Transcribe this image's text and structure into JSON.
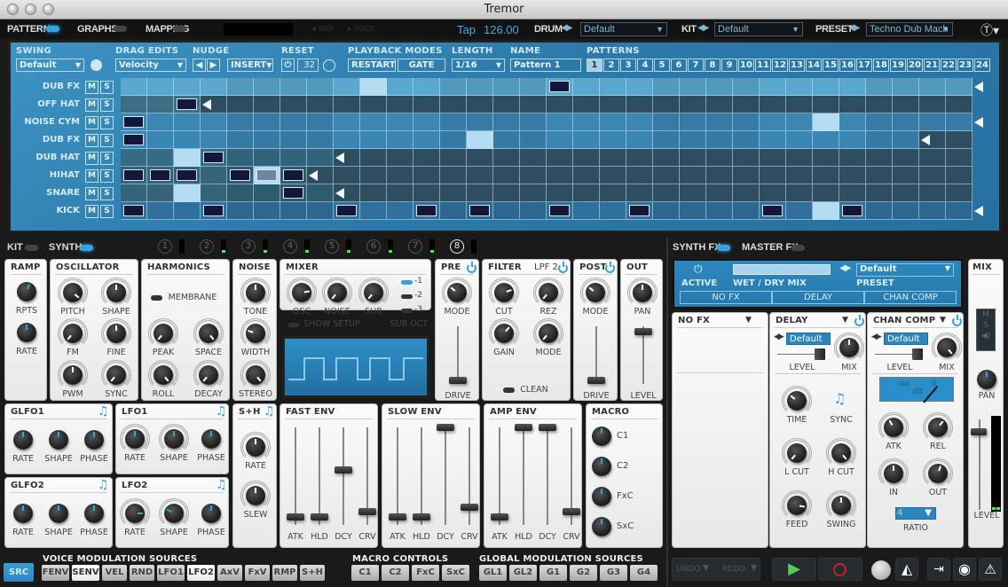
{
  "window": {
    "title": "Tremor"
  },
  "nav": {
    "pattern": "PATTERN",
    "graphs": "GRAPHS",
    "mapping": "MAPPING",
    "midi": "MIDI",
    "voice": "VOICE",
    "tap": "Tap",
    "tempo": "126.00",
    "drum_label": "DRUM",
    "drum_value": "Default",
    "kit_label": "KIT",
    "kit_value": "Default",
    "preset_label": "PRESET",
    "preset_value": "Techno Dub Mach"
  },
  "sequencer": {
    "swing_label": "SWING",
    "swing_value": "Default",
    "drag_label": "DRAG EDITS",
    "drag_value": "Velocity",
    "nudge_label": "NUDGE",
    "insert_value": "INSERT",
    "reset_label": "RESET",
    "reset_value": "32",
    "playback_label": "PLAYBACK MODES",
    "restart": "RESTART",
    "gate": "GATE",
    "length_label": "LENGTH",
    "length_value": "1/16",
    "name_label": "NAME",
    "name_value": "Pattern 1",
    "patterns_label": "PATTERNS",
    "patterns": [
      "1",
      "2",
      "3",
      "4",
      "5",
      "6",
      "7",
      "8",
      "9",
      "10",
      "11",
      "12",
      "13",
      "14",
      "15",
      "16",
      "17",
      "18",
      "19",
      "20",
      "21",
      "22",
      "23",
      "24"
    ],
    "active_pattern": "1",
    "rows": [
      {
        "name": "DUB FX",
        "length": 32,
        "notes": [
          16
        ],
        "highlight": [
          9
        ]
      },
      {
        "name": "OFF HAT",
        "length": 3,
        "notes": [
          2
        ],
        "highlight": []
      },
      {
        "name": "NOISE CYM",
        "length": 32,
        "notes": [
          0
        ],
        "highlight": [
          26
        ]
      },
      {
        "name": "DUB FX",
        "length": 30,
        "notes": [
          0
        ],
        "highlight": [
          13
        ]
      },
      {
        "name": "DUB HAT",
        "length": 8,
        "notes": [
          3
        ],
        "highlight": [
          2
        ]
      },
      {
        "name": "HIHAT",
        "length": 7,
        "notes": [
          0,
          1,
          2,
          4,
          5,
          6
        ],
        "highlight": [
          5
        ]
      },
      {
        "name": "SNARE",
        "length": 8,
        "notes": [
          6
        ],
        "highlight": [
          2
        ]
      },
      {
        "name": "KICK",
        "length": 32,
        "notes": [
          0,
          3,
          8,
          11,
          13,
          16,
          19,
          24,
          27
        ],
        "highlight": [
          26
        ]
      }
    ],
    "mute": "M",
    "solo": "S"
  },
  "lower": {
    "kit": "KIT",
    "synth": "SYNTH",
    "voices": [
      "1",
      "2",
      "3",
      "4",
      "5",
      "6",
      "7",
      "8"
    ],
    "active_voice": "8"
  },
  "panels": {
    "ramp": {
      "title": "RAMP",
      "knobs": [
        "RPTS",
        "RATE"
      ]
    },
    "osc": {
      "title": "OSCILLATOR",
      "knobs": [
        "PITCH",
        "SHAPE",
        "FM",
        "FINE",
        "PWM",
        "SYNC"
      ]
    },
    "harm": {
      "title": "HARMONICS",
      "membrane": "MEMBRANE",
      "knobs": [
        "PEAK",
        "SPACE",
        "ROLL",
        "DECAY"
      ]
    },
    "noise": {
      "title": "NOISE",
      "knobs": [
        "TONE",
        "WIDTH",
        "STEREO"
      ]
    },
    "mixer": {
      "title": "MIXER",
      "knobs": [
        "OSC",
        "NOISE",
        "SUB"
      ],
      "show_setup": "SHOW SETUP",
      "sub_oct": "SUB OCT",
      "oct": [
        "-1",
        "-2",
        "-3"
      ]
    },
    "pre": {
      "title": "PRE",
      "mode": "MODE",
      "drive": "DRIVE"
    },
    "filter": {
      "title": "FILTER",
      "type": "LPF 2",
      "knobs": [
        "CUT",
        "REZ",
        "GAIN",
        "MODE"
      ],
      "clean": "CLEAN"
    },
    "post": {
      "title": "POST",
      "mode": "MODE",
      "drive": "DRIVE"
    },
    "out": {
      "title": "OUT",
      "pan": "PAN",
      "level": "LEVEL"
    },
    "glfo1": {
      "title": "GLFO1",
      "knobs": [
        "RATE",
        "SHAPE",
        "PHASE"
      ]
    },
    "lfo1": {
      "title": "LFO1",
      "knobs": [
        "RATE",
        "SHAPE",
        "PHASE"
      ]
    },
    "glfo2": {
      "title": "GLFO2",
      "knobs": [
        "RATE",
        "SHAPE",
        "PHASE"
      ]
    },
    "lfo2": {
      "title": "LFO2",
      "knobs": [
        "RATE",
        "SHAPE",
        "PHASE"
      ]
    },
    "sh": {
      "title": "S+H",
      "knobs": [
        "RATE",
        "SLEW"
      ]
    },
    "fastenv": {
      "title": "FAST ENV",
      "faders": [
        "ATK",
        "HLD",
        "DCY",
        "CRV"
      ],
      "values": [
        0.05,
        0.05,
        0.55,
        0.1
      ]
    },
    "slowenv": {
      "title": "SLOW ENV",
      "faders": [
        "ATK",
        "HLD",
        "DCY",
        "CRV"
      ],
      "values": [
        0.05,
        0.05,
        1.0,
        0.15
      ]
    },
    "ampenv": {
      "title": "AMP ENV",
      "faders": [
        "ATK",
        "HLD",
        "DCY",
        "CRV"
      ],
      "values": [
        0.05,
        1.0,
        1.0,
        0.1
      ]
    },
    "macro": {
      "title": "MACRO",
      "knobs": [
        "C1",
        "C2",
        "FxC",
        "SxC"
      ]
    }
  },
  "fx": {
    "synth_fx": "SYNTH FX",
    "master_fx": "MASTER FX",
    "active": "ACTIVE",
    "wetdry": "WET / DRY MIX",
    "preset_label": "PRESET",
    "preset_value": "Default",
    "slots": [
      "NO FX",
      "DELAY",
      "CHAN COMP"
    ],
    "nofx": {
      "title": "NO FX"
    },
    "delay": {
      "title": "DELAY",
      "preset": "Default",
      "level": "LEVEL",
      "mix": "MIX",
      "knobs": [
        "TIME",
        "SYNC",
        "L CUT",
        "H CUT",
        "FEED",
        "SWING"
      ]
    },
    "comp": {
      "title": "CHAN COMP",
      "preset": "Default",
      "level": "LEVEL",
      "mix": "MIX",
      "meter_min": "-oo",
      "meter_max": "0",
      "meter_unit": "dB",
      "knobs": [
        "ATK",
        "REL",
        "IN",
        "OUT"
      ],
      "ratio_label": "RATIO",
      "ratio_value": "4"
    },
    "mix": {
      "title": "MIX",
      "m": "M",
      "s": "S",
      "pan": "PAN",
      "level": "LEVEL"
    }
  },
  "bottom": {
    "src": "SRC",
    "voice_mod_label": "VOICE MODULATION SOURCES",
    "voice_mod": [
      "FENV",
      "SENV",
      "VEL",
      "RND",
      "LFO1",
      "LFO2",
      "AxV",
      "FxV",
      "RMP",
      "S+H"
    ],
    "voice_mod_active": [
      "SENV",
      "LFO2"
    ],
    "macro_label": "MACRO CONTROLS",
    "macro": [
      "C1",
      "C2",
      "FxC",
      "SxC"
    ],
    "global_label": "GLOBAL MODULATION SOURCES",
    "global": [
      "GL1",
      "GL2",
      "G1",
      "G2",
      "G3",
      "G4"
    ],
    "undo": "UNDO",
    "redo": "REDO"
  }
}
